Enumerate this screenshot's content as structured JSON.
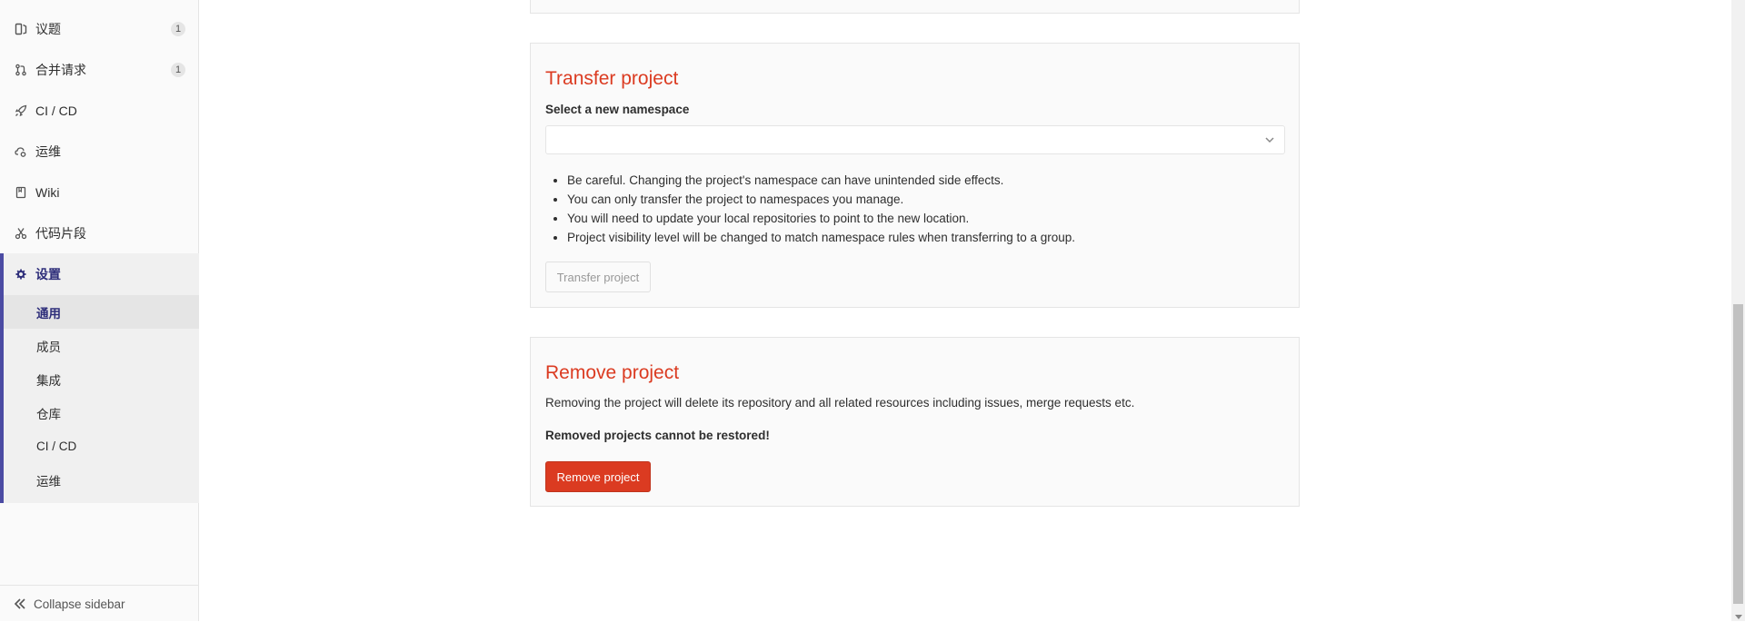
{
  "sidebar": {
    "items": [
      {
        "label": "议题",
        "count": "1",
        "icon": "issues-icon"
      },
      {
        "label": "合并请求",
        "count": "1",
        "icon": "merge-request-icon"
      },
      {
        "label": "CI / CD",
        "icon": "rocket-icon"
      },
      {
        "label": "运维",
        "icon": "cloud-gear-icon"
      },
      {
        "label": "Wiki",
        "icon": "book-icon"
      },
      {
        "label": "代码片段",
        "icon": "scissors-icon"
      }
    ],
    "settings": {
      "label": "设置",
      "icon": "gear-icon",
      "sub_items": [
        {
          "label": "通用",
          "active": true
        },
        {
          "label": "成员"
        },
        {
          "label": "集成"
        },
        {
          "label": "仓库"
        },
        {
          "label": "CI / CD"
        },
        {
          "label": "运维"
        }
      ]
    },
    "collapse_label": "Collapse sidebar"
  },
  "transfer": {
    "title": "Transfer project",
    "select_label": "Select a new namespace",
    "select_value": "",
    "bullets": [
      "Be careful. Changing the project's namespace can have unintended side effects.",
      "You can only transfer the project to namespaces you manage.",
      "You will need to update your local repositories to point to the new location.",
      "Project visibility level will be changed to match namespace rules when transferring to a group."
    ],
    "button_label": "Transfer project"
  },
  "remove": {
    "title": "Remove project",
    "description": "Removing the project will delete its repository and all related resources including issues, merge requests etc.",
    "warning": "Removed projects cannot be restored!",
    "button_label": "Remove project"
  },
  "colors": {
    "accent": "#4b4ba3",
    "danger": "#db3b21"
  }
}
